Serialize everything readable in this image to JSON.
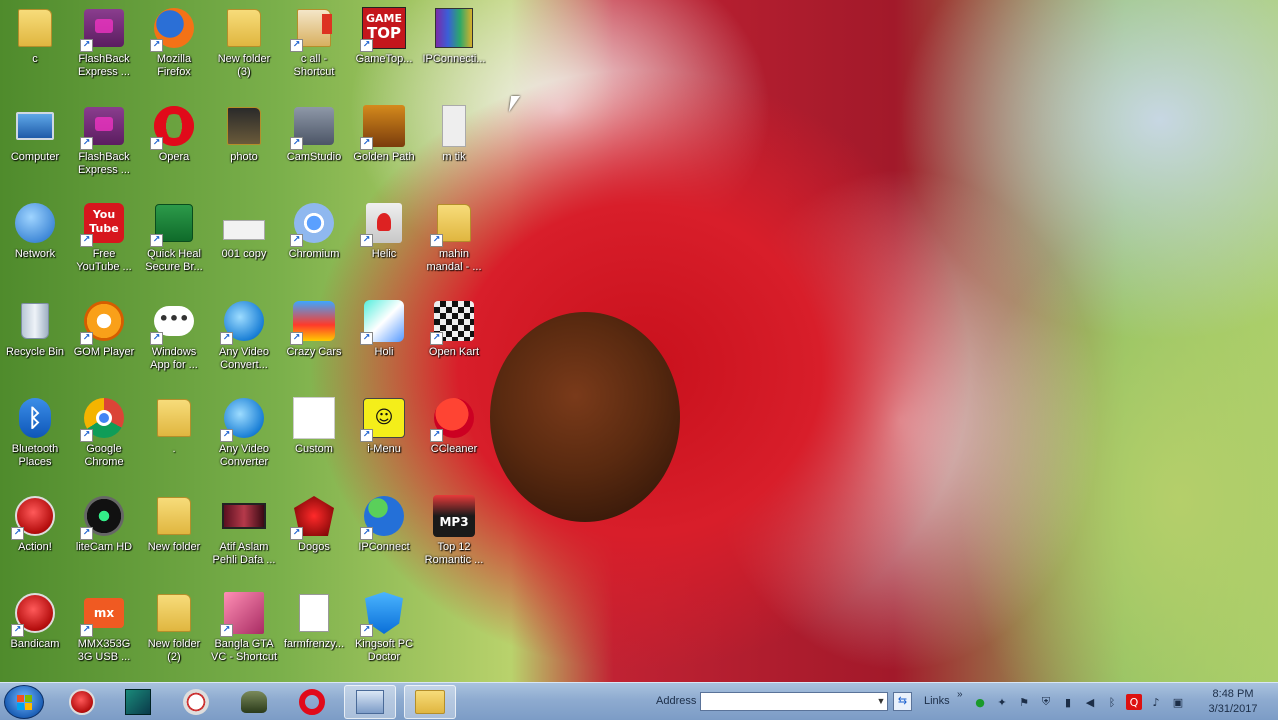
{
  "desktop": {
    "icons": [
      {
        "label": "c",
        "icon": "user-folder-icon",
        "kind": "folder",
        "shortcut": false
      },
      {
        "label": "Computer",
        "icon": "computer-icon",
        "kind": "computer",
        "shortcut": false
      },
      {
        "label": "Network",
        "icon": "network-icon",
        "kind": "network",
        "shortcut": false
      },
      {
        "label": "Recycle Bin",
        "icon": "recycle-bin-icon",
        "kind": "bin",
        "shortcut": false
      },
      {
        "label": "Bluetooth\nPlaces",
        "icon": "bluetooth-icon",
        "kind": "bluetooth",
        "shortcut": false
      },
      {
        "label": "Action!",
        "icon": "action-icon",
        "kind": "red-round",
        "shortcut": true
      },
      {
        "label": "Bandicam",
        "icon": "bandicam-icon",
        "kind": "red-round",
        "shortcut": true
      },
      {
        "label": "FlashBack\nExpress ...",
        "icon": "flashback-icon",
        "kind": "purple",
        "shortcut": true
      },
      {
        "label": "FlashBack\nExpress ...",
        "icon": "flashback-icon",
        "kind": "purple",
        "shortcut": true
      },
      {
        "label": "Free\nYouTube ...",
        "icon": "youtube-icon",
        "kind": "youtube",
        "shortcut": true
      },
      {
        "label": "GOM Player",
        "icon": "gom-player-icon",
        "kind": "gom",
        "shortcut": true
      },
      {
        "label": "Google\nChrome",
        "icon": "chrome-icon",
        "kind": "chrome",
        "shortcut": true
      },
      {
        "label": "liteCam HD",
        "icon": "litecam-icon",
        "kind": "litecam",
        "shortcut": true
      },
      {
        "label": "MMX353G\n3G USB ...",
        "icon": "micromax-icon",
        "kind": "micromax",
        "shortcut": true
      },
      {
        "label": "Mozilla\nFirefox",
        "icon": "firefox-icon",
        "kind": "firefox",
        "shortcut": true
      },
      {
        "label": "Opera",
        "icon": "opera-icon",
        "kind": "opera",
        "shortcut": true
      },
      {
        "label": "Quick Heal\nSecure Br...",
        "icon": "quickheal-icon",
        "kind": "quickheal",
        "shortcut": true
      },
      {
        "label": "Windows\nApp for ...",
        "icon": "chat-bubble-icon",
        "kind": "chat",
        "shortcut": true
      },
      {
        "label": ".",
        "icon": "folder-icon",
        "kind": "folder",
        "shortcut": false
      },
      {
        "label": "New folder",
        "icon": "folder-icon",
        "kind": "folder",
        "shortcut": false
      },
      {
        "label": "New folder\n(2)",
        "icon": "folder-icon",
        "kind": "folder",
        "shortcut": false
      },
      {
        "label": "New folder\n(3)",
        "icon": "folder-icon",
        "kind": "folder",
        "shortcut": false
      },
      {
        "label": "photo",
        "icon": "folder-icon",
        "kind": "folder-dark",
        "shortcut": false
      },
      {
        "label": "001 copy",
        "icon": "image-file-icon",
        "kind": "image",
        "shortcut": false
      },
      {
        "label": "Any Video\nConvert...",
        "icon": "any-video-icon",
        "kind": "anyvideo",
        "shortcut": true
      },
      {
        "label": "Any Video\nConverter",
        "icon": "any-video-icon",
        "kind": "anyvideo",
        "shortcut": true
      },
      {
        "label": "Atif Aslam\nPehli Dafa ...",
        "icon": "video-file-icon",
        "kind": "video",
        "shortcut": false
      },
      {
        "label": "Bangla GTA\nVC - Shortcut",
        "icon": "gta-icon",
        "kind": "gta",
        "shortcut": true
      },
      {
        "label": "c all -\nShortcut",
        "icon": "folder-shortcut-icon",
        "kind": "folder-red",
        "shortcut": true
      },
      {
        "label": "CamStudio",
        "icon": "camstudio-icon",
        "kind": "camstudio",
        "shortcut": true
      },
      {
        "label": "Chromium",
        "icon": "chromium-icon",
        "kind": "chromium",
        "shortcut": true
      },
      {
        "label": "Crazy Cars",
        "icon": "crazy-cars-icon",
        "kind": "crazycars",
        "shortcut": true
      },
      {
        "label": "Custom",
        "icon": "blank-file-icon",
        "kind": "blank",
        "shortcut": false
      },
      {
        "label": "Dogos",
        "icon": "dogos-icon",
        "kind": "dogos",
        "shortcut": true
      },
      {
        "label": "farmfrenzy...",
        "icon": "document-icon",
        "kind": "doc",
        "shortcut": false
      },
      {
        "label": "GameTop...",
        "icon": "gametop-icon",
        "kind": "gametop",
        "shortcut": true
      },
      {
        "label": "Golden Path",
        "icon": "golden-path-icon",
        "kind": "golden",
        "shortcut": true
      },
      {
        "label": "Helic",
        "icon": "helic-icon",
        "kind": "helic",
        "shortcut": true
      },
      {
        "label": "Holi",
        "icon": "holi-icon",
        "kind": "holi",
        "shortcut": true
      },
      {
        "label": "i-Menu",
        "icon": "i-menu-icon",
        "kind": "imenu",
        "shortcut": true
      },
      {
        "label": "IPConnect",
        "icon": "ipconnect-icon",
        "kind": "ipconnect",
        "shortcut": true
      },
      {
        "label": "Kingsoft PC\nDoctor",
        "icon": "kingsoft-icon",
        "kind": "kingsoft",
        "shortcut": true
      },
      {
        "label": "IPConnecti...",
        "icon": "winrar-icon",
        "kind": "winrar",
        "shortcut": false
      },
      {
        "label": "m tik",
        "icon": "sketch-image-icon",
        "kind": "sketch",
        "shortcut": false
      },
      {
        "label": "mahin\nmandal - ...",
        "icon": "folder-shortcut-icon",
        "kind": "folder",
        "shortcut": true
      },
      {
        "label": "Open Kart",
        "icon": "open-kart-icon",
        "kind": "openkart",
        "shortcut": true
      },
      {
        "label": "CCleaner",
        "icon": "ccleaner-icon",
        "kind": "ccleaner",
        "shortcut": true
      },
      {
        "label": "Top 12\nRomantic ...",
        "icon": "mp3-icon",
        "kind": "mp3",
        "shortcut": false
      }
    ]
  },
  "taskbar": {
    "start": {
      "icon": "windows-start-icon"
    },
    "pinned": [
      {
        "icon": "bandicam-taskbar-icon",
        "active": false
      },
      {
        "icon": "camtasia-taskbar-icon",
        "active": false
      },
      {
        "icon": "compass-taskbar-icon",
        "active": false
      },
      {
        "icon": "gamer-taskbar-icon",
        "active": false
      },
      {
        "icon": "opera-taskbar-icon",
        "active": false
      },
      {
        "icon": "control-panel-taskbar-icon",
        "active": true
      },
      {
        "icon": "explorer-taskbar-icon",
        "active": true
      }
    ],
    "address_label": "Address",
    "address_value": "",
    "links_label": "Links",
    "links_chevron": "»",
    "tray": [
      {
        "icon": "network-tray-icon",
        "glyph": "●"
      },
      {
        "icon": "gamepad-tray-icon",
        "glyph": "✦"
      },
      {
        "icon": "flag-tray-icon",
        "glyph": "⚑"
      },
      {
        "icon": "shield-tray-icon",
        "glyph": "⛨"
      },
      {
        "icon": "battery-tray-icon",
        "glyph": "▮"
      },
      {
        "icon": "volume-tray-icon",
        "glyph": "◀"
      },
      {
        "icon": "bluetooth-tray-icon",
        "glyph": "ᛒ"
      },
      {
        "icon": "quickheal-tray-icon",
        "glyph": "Q"
      },
      {
        "icon": "speaker-tray-icon",
        "glyph": "♪"
      },
      {
        "icon": "display-tray-icon",
        "glyph": "▣"
      }
    ],
    "clock": {
      "time": "8:48 PM",
      "date": "3/31/2017"
    }
  },
  "colors": {
    "taskbar": "#8eabd0",
    "label_text": "#ffffff"
  }
}
